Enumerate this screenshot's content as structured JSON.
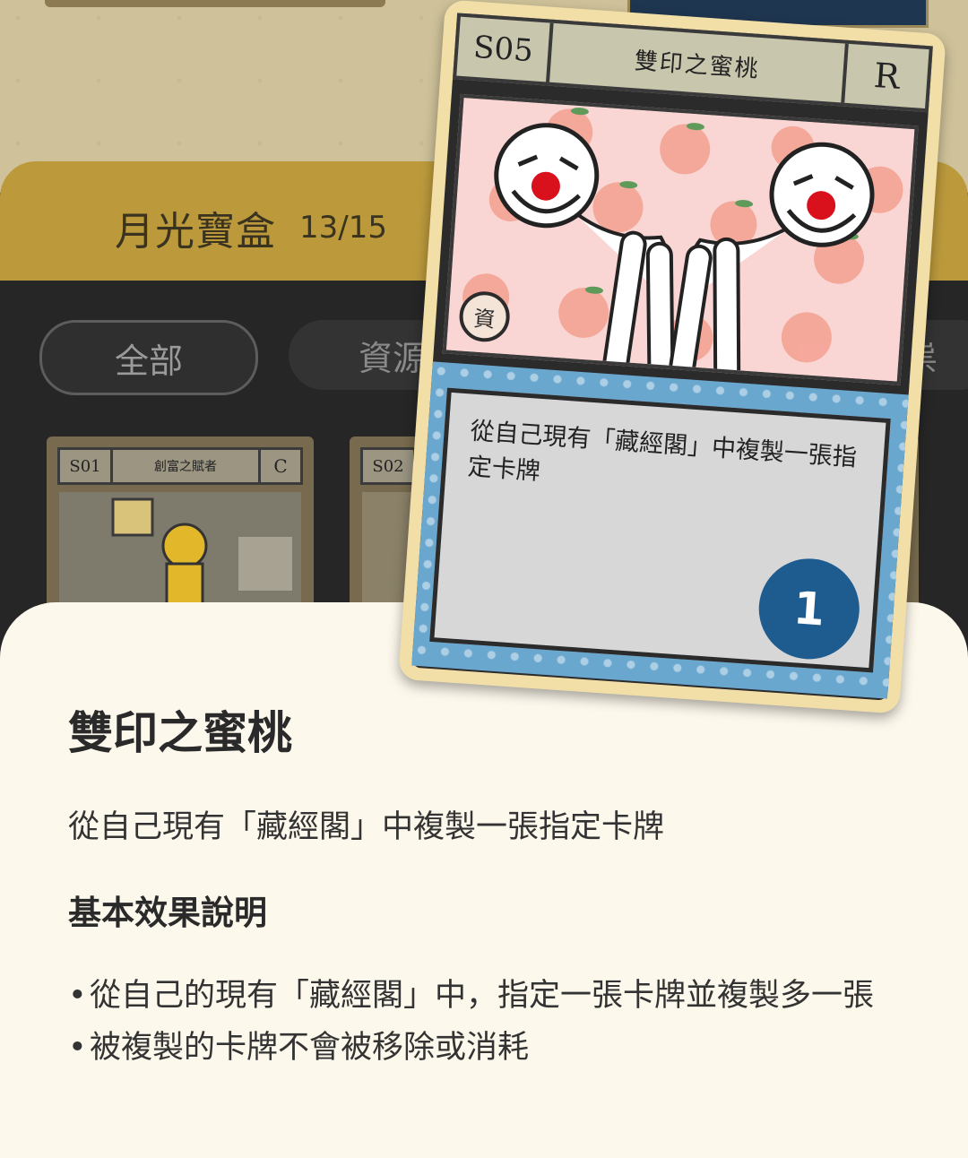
{
  "header": {
    "title": "月光寶盒",
    "count": "13/15"
  },
  "filters": [
    {
      "label": "全部"
    },
    {
      "label": "資源"
    },
    {
      "label": "祟"
    }
  ],
  "grid": [
    {
      "code": "S01",
      "name": "創富之賦者",
      "rarity": "C"
    },
    {
      "code": "S02"
    }
  ],
  "card": {
    "code": "S05",
    "name": "雙印之蜜桃",
    "rarity": "R",
    "stamp": "資",
    "text": "從自己現有「藏經閣」中複製一張指定卡牌",
    "cost": "1",
    "colors": {
      "frame": "#f2dfa8",
      "border": "#2b2b2b",
      "textframe": "#6aa7cf",
      "badge": "#1e5b8f",
      "art_bg": "#f9d6d3"
    }
  },
  "sheet": {
    "title": "雙印之蜜桃",
    "description": "從自己現有「藏經閣」中複製一張指定卡牌",
    "section_title": "基本效果說明",
    "bullets": [
      "從自己的現有「藏經閣」中，指定一張卡牌並複製多一張",
      "被複製的卡牌不會被移除或消耗"
    ],
    "bullet_glyph": "•"
  },
  "theme": {
    "accent": "#bc9a3c",
    "sheet_bg": "#fdf8ec",
    "dark_bg": "#262626"
  }
}
